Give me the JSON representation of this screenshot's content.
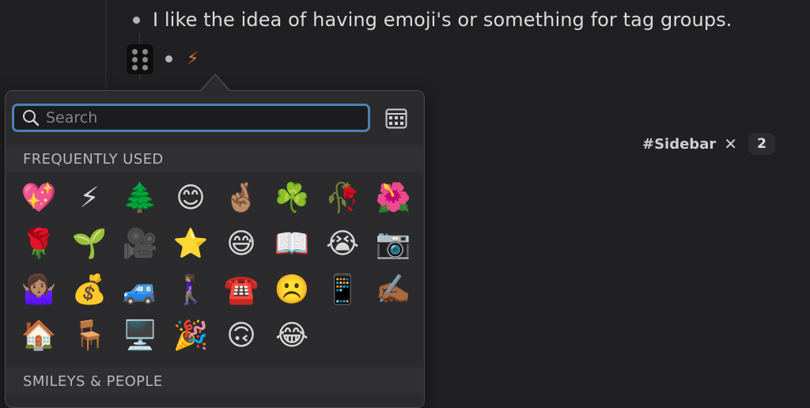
{
  "note": {
    "bullet_text": "I like the idea of having emoji's or something for tag groups.",
    "second_bullet_emoji": "⚡"
  },
  "sidebar_tag": {
    "label": "#Sidebar",
    "close": "✕",
    "count": "2"
  },
  "emoji_picker": {
    "search": {
      "placeholder": "Search",
      "value": ""
    },
    "sections": {
      "frequently_used": "FREQUENTLY USED",
      "smileys_people": "SMILEYS & PEOPLE"
    },
    "emojis": [
      "💖",
      "⚡",
      "🌲",
      "😊",
      "🤞🏽",
      "☘️",
      "🥀",
      "🌺",
      "🌹",
      "🌱",
      "🎥",
      "⭐",
      "😅",
      "📖",
      "😭",
      "📷",
      "🤷🏽‍♀️",
      "💰",
      "🚙",
      "🚶🏽‍♀️",
      "☎️",
      "☹️",
      "📱",
      "✍🏾",
      "🏠",
      "🪑",
      "🖥️",
      "🎉",
      "🙃",
      "😂"
    ],
    "icons": {
      "search": "search-icon",
      "viewer": "character-viewer-icon"
    }
  },
  "colors": {
    "background": "#202022",
    "popover": "#2b2b2d",
    "search_focus": "#4d7fb6"
  }
}
